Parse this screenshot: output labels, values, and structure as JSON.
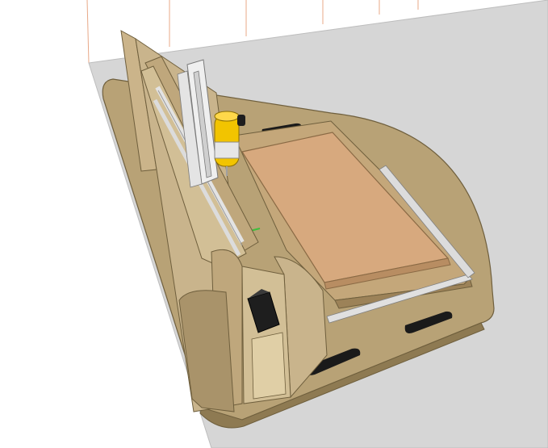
{
  "scene": {
    "subject": "cnc-router-3d-model",
    "colors": {
      "background": "#ffffff",
      "ground": "#d6d6d6",
      "grid": "#e8a080",
      "plywood": "#b09a6e",
      "plywood_dark": "#8e7a52",
      "plywood_edge": "#c9b48c",
      "mdf_top": "#d7a97e",
      "rail": "#d9d9d9",
      "router_body": "#f2c400",
      "motor": "#1e1e1e",
      "slot": "#1a1a1a",
      "accent_green": "#3cbf3c"
    },
    "icons": [
      "router-icon",
      "stepper-motor-icon"
    ]
  }
}
